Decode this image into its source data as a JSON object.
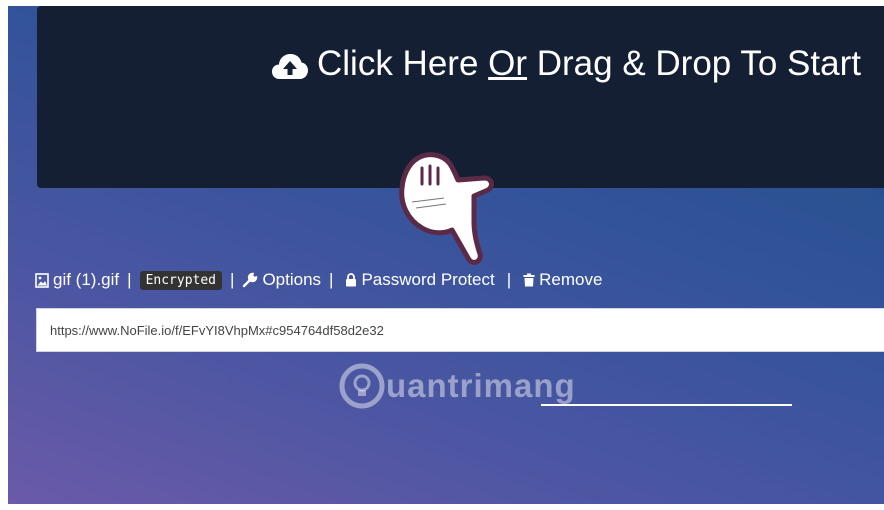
{
  "dropzone": {
    "title_before": "Click Here ",
    "title_or": "Or",
    "title_after": " Drag & Drop To Start",
    "icon": "cloud-upload-icon"
  },
  "file": {
    "name": "gif (1).gif",
    "badge": "Encrypted",
    "options_label": "Options",
    "password_label": "Password Protect",
    "remove_label": "Remove",
    "separator": "|"
  },
  "url": {
    "value": "https://www.NoFile.io/f/EFvYI8VhpMx#c954764df58d2e32"
  },
  "watermark": {
    "text": "uantrimang"
  },
  "colors": {
    "dropzone": "#151f33",
    "badge": "#333333",
    "accent": "#ffffff"
  }
}
